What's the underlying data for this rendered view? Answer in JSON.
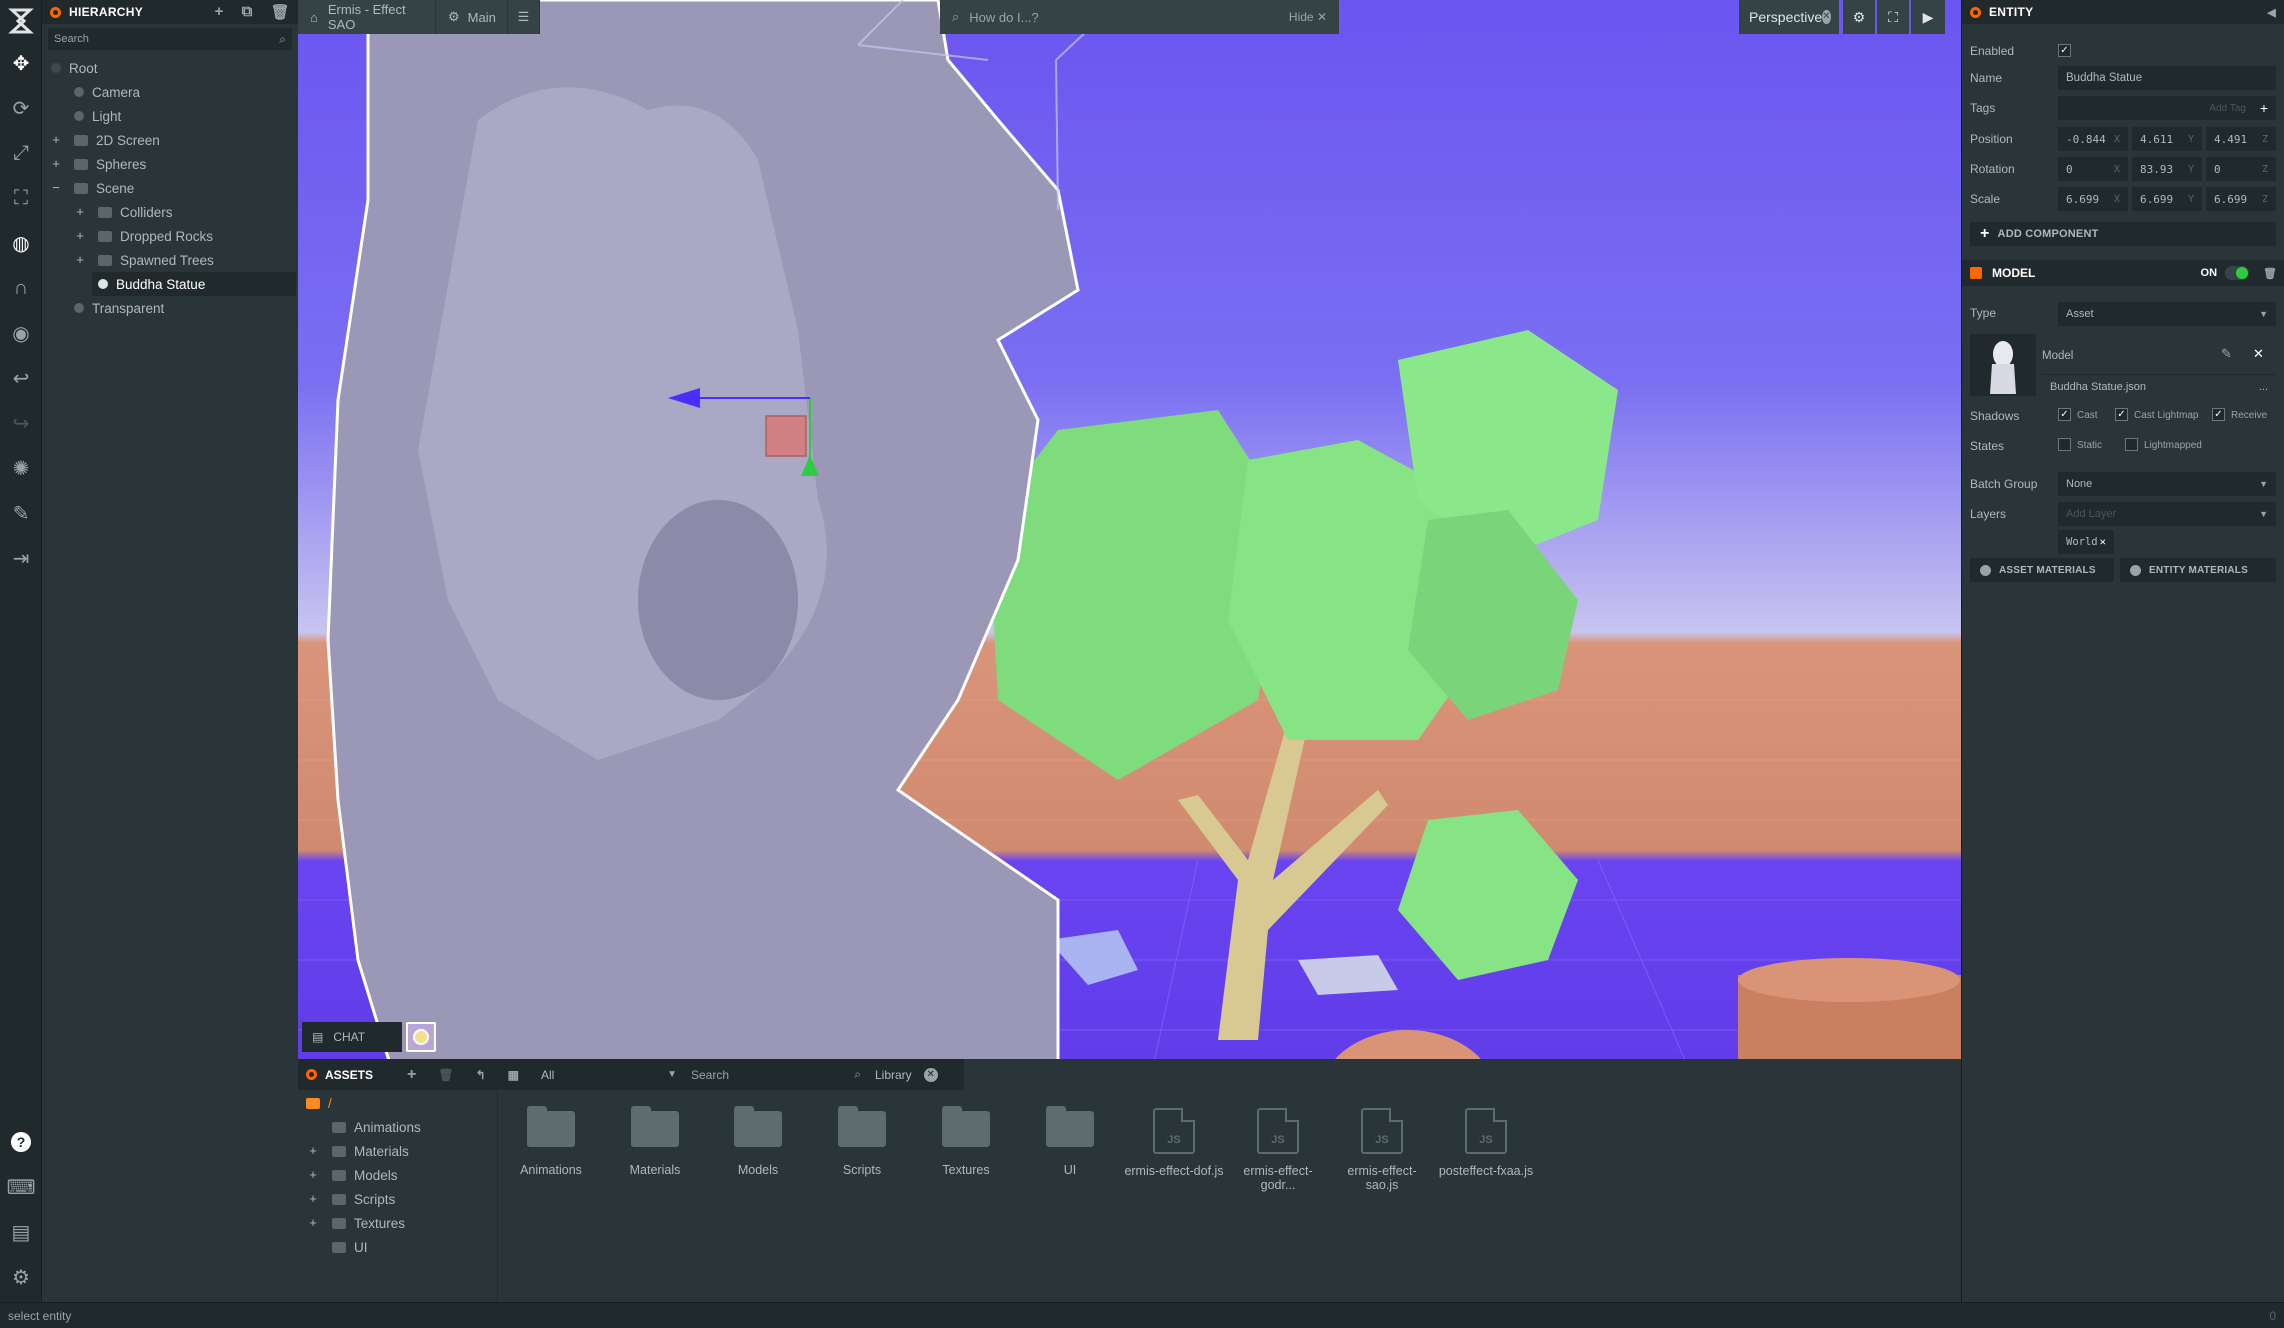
{
  "hierarchy": {
    "title": "HIERARCHY",
    "search_placeholder": "Search",
    "nodes": [
      {
        "label": "Root",
        "expander": ""
      },
      {
        "label": "Camera",
        "expander": ""
      },
      {
        "label": "Light",
        "expander": ""
      },
      {
        "label": "2D Screen",
        "expander": "+"
      },
      {
        "label": "Spheres",
        "expander": "+"
      },
      {
        "label": "Scene",
        "expander": "−"
      },
      {
        "label": "Colliders",
        "expander": "+"
      },
      {
        "label": "Dropped Rocks",
        "expander": "+"
      },
      {
        "label": "Spawned Trees",
        "expander": "+"
      },
      {
        "label": "Buddha Statue",
        "expander": ""
      },
      {
        "label": "Transparent",
        "expander": ""
      }
    ]
  },
  "viewport": {
    "breadcrumb_project": "Ermis - Effect SAO",
    "breadcrumb_scene": "Main",
    "howdoi_placeholder": "How do I...?",
    "hide_label": "Hide",
    "camera_mode": "Perspective"
  },
  "inspector": {
    "title": "ENTITY",
    "enabled_label": "Enabled",
    "name_label": "Name",
    "name_value": "Buddha Statue",
    "tags_label": "Tags",
    "tags_placeholder": "Add Tag",
    "position_label": "Position",
    "position": {
      "x": "-0.844",
      "y": "4.611",
      "z": "4.491"
    },
    "rotation_label": "Rotation",
    "rotation": {
      "x": "0",
      "y": "83.93",
      "z": "0"
    },
    "scale_label": "Scale",
    "scale": {
      "x": "6.699",
      "y": "6.699",
      "z": "6.699"
    },
    "axis_x": "X",
    "axis_y": "Y",
    "axis_z": "Z",
    "add_component": "ADD COMPONENT",
    "model": {
      "title": "MODEL",
      "on_label": "ON",
      "type_label": "Type",
      "type_value": "Asset",
      "model_label": "Model",
      "asset_name": "Buddha Statue.json",
      "asset_more": "...",
      "shadows_label": "Shadows",
      "cast": "Cast",
      "cast_lightmap": "Cast Lightmap",
      "receive": "Receive",
      "states_label": "States",
      "static": "Static",
      "lightmapped": "Lightmapped",
      "batch_group_label": "Batch Group",
      "batch_group_value": "None",
      "layers_label": "Layers",
      "layers_placeholder": "Add Layer",
      "layer_tag": "World",
      "asset_materials": "ASSET MATERIALS",
      "entity_materials": "ENTITY MATERIALS"
    }
  },
  "chat": {
    "label": "CHAT"
  },
  "assets": {
    "title": "ASSETS",
    "filter_value": "All",
    "search_placeholder": "Search",
    "library_label": "Library",
    "root_path": "/",
    "tree": [
      {
        "label": "Animations",
        "expander": ""
      },
      {
        "label": "Materials",
        "expander": "+"
      },
      {
        "label": "Models",
        "expander": "+"
      },
      {
        "label": "Scripts",
        "expander": "+"
      },
      {
        "label": "Textures",
        "expander": "+"
      },
      {
        "label": "UI",
        "expander": ""
      }
    ],
    "items": [
      {
        "label": "Animations",
        "kind": "folder"
      },
      {
        "label": "Materials",
        "kind": "folder"
      },
      {
        "label": "Models",
        "kind": "folder"
      },
      {
        "label": "Scripts",
        "kind": "folder"
      },
      {
        "label": "Textures",
        "kind": "folder"
      },
      {
        "label": "UI",
        "kind": "folder"
      },
      {
        "label": "ermis-effect-dof.js",
        "kind": "script"
      },
      {
        "label": "ermis-effect-godr...",
        "kind": "script"
      },
      {
        "label": "ermis-effect-sao.js",
        "kind": "script"
      },
      {
        "label": "posteffect-fxaa.js",
        "kind": "script"
      }
    ],
    "js_badge": "JS"
  },
  "statusbar": {
    "text": "select entity",
    "right": "0"
  },
  "colors": {
    "accent": "#ff6600",
    "toggle_on": "#2ecc40",
    "panel": "#293538",
    "panel_dark": "#20292b"
  }
}
